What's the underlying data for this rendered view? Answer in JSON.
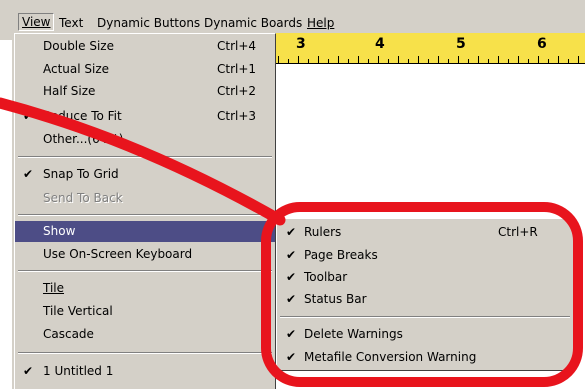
{
  "menubar": {
    "items": [
      "View",
      "Text",
      "Dynamic Buttons",
      "Dynamic Boards",
      "Help"
    ]
  },
  "ruler": {
    "numbers": [
      "3",
      "4",
      "5",
      "6"
    ]
  },
  "view_menu": {
    "items": [
      {
        "label": "Double Size",
        "shortcut": "Ctrl+4",
        "checked": false
      },
      {
        "label": "Actual Size",
        "shortcut": "Ctrl+1",
        "checked": false
      },
      {
        "label": "Half Size",
        "shortcut": "Ctrl+2",
        "checked": false
      },
      {
        "label": "Reduce To Fit",
        "shortcut": "Ctrl+3",
        "checked": true
      },
      {
        "label": "Other...(64%)",
        "shortcut": "",
        "checked": false
      },
      {
        "label": "Snap To Grid",
        "shortcut": "",
        "checked": true
      },
      {
        "label": "Send To Back",
        "shortcut": "",
        "checked": false,
        "disabled": true
      },
      {
        "label": "Show",
        "shortcut": "",
        "checked": false,
        "highlighted": true
      },
      {
        "label": "Use On-Screen Keyboard",
        "shortcut": "",
        "checked": false
      },
      {
        "label": "Tile",
        "shortcut": "",
        "checked": false
      },
      {
        "label": "Tile Vertical",
        "shortcut": "",
        "checked": false
      },
      {
        "label": "Cascade",
        "shortcut": "",
        "checked": false
      },
      {
        "label": "1 Untitled 1",
        "shortcut": "",
        "checked": true
      }
    ],
    "check_mark": "✔"
  },
  "show_submenu": {
    "items": [
      {
        "label": "Rulers",
        "shortcut": "Ctrl+R",
        "checked": true
      },
      {
        "label": "Page Breaks",
        "shortcut": "",
        "checked": true
      },
      {
        "label": "Toolbar",
        "shortcut": "",
        "checked": true
      },
      {
        "label": "Status Bar",
        "shortcut": "",
        "checked": true
      },
      {
        "label": "Delete Warnings",
        "shortcut": "",
        "checked": true
      },
      {
        "label": "Metafile Conversion Warning",
        "shortcut": "",
        "checked": true
      }
    ],
    "check_mark": "✔"
  },
  "annotation": {
    "color": "#e8141d"
  },
  "colors": {
    "highlight": "#4d4d86",
    "ruler": "#f7e14a"
  }
}
